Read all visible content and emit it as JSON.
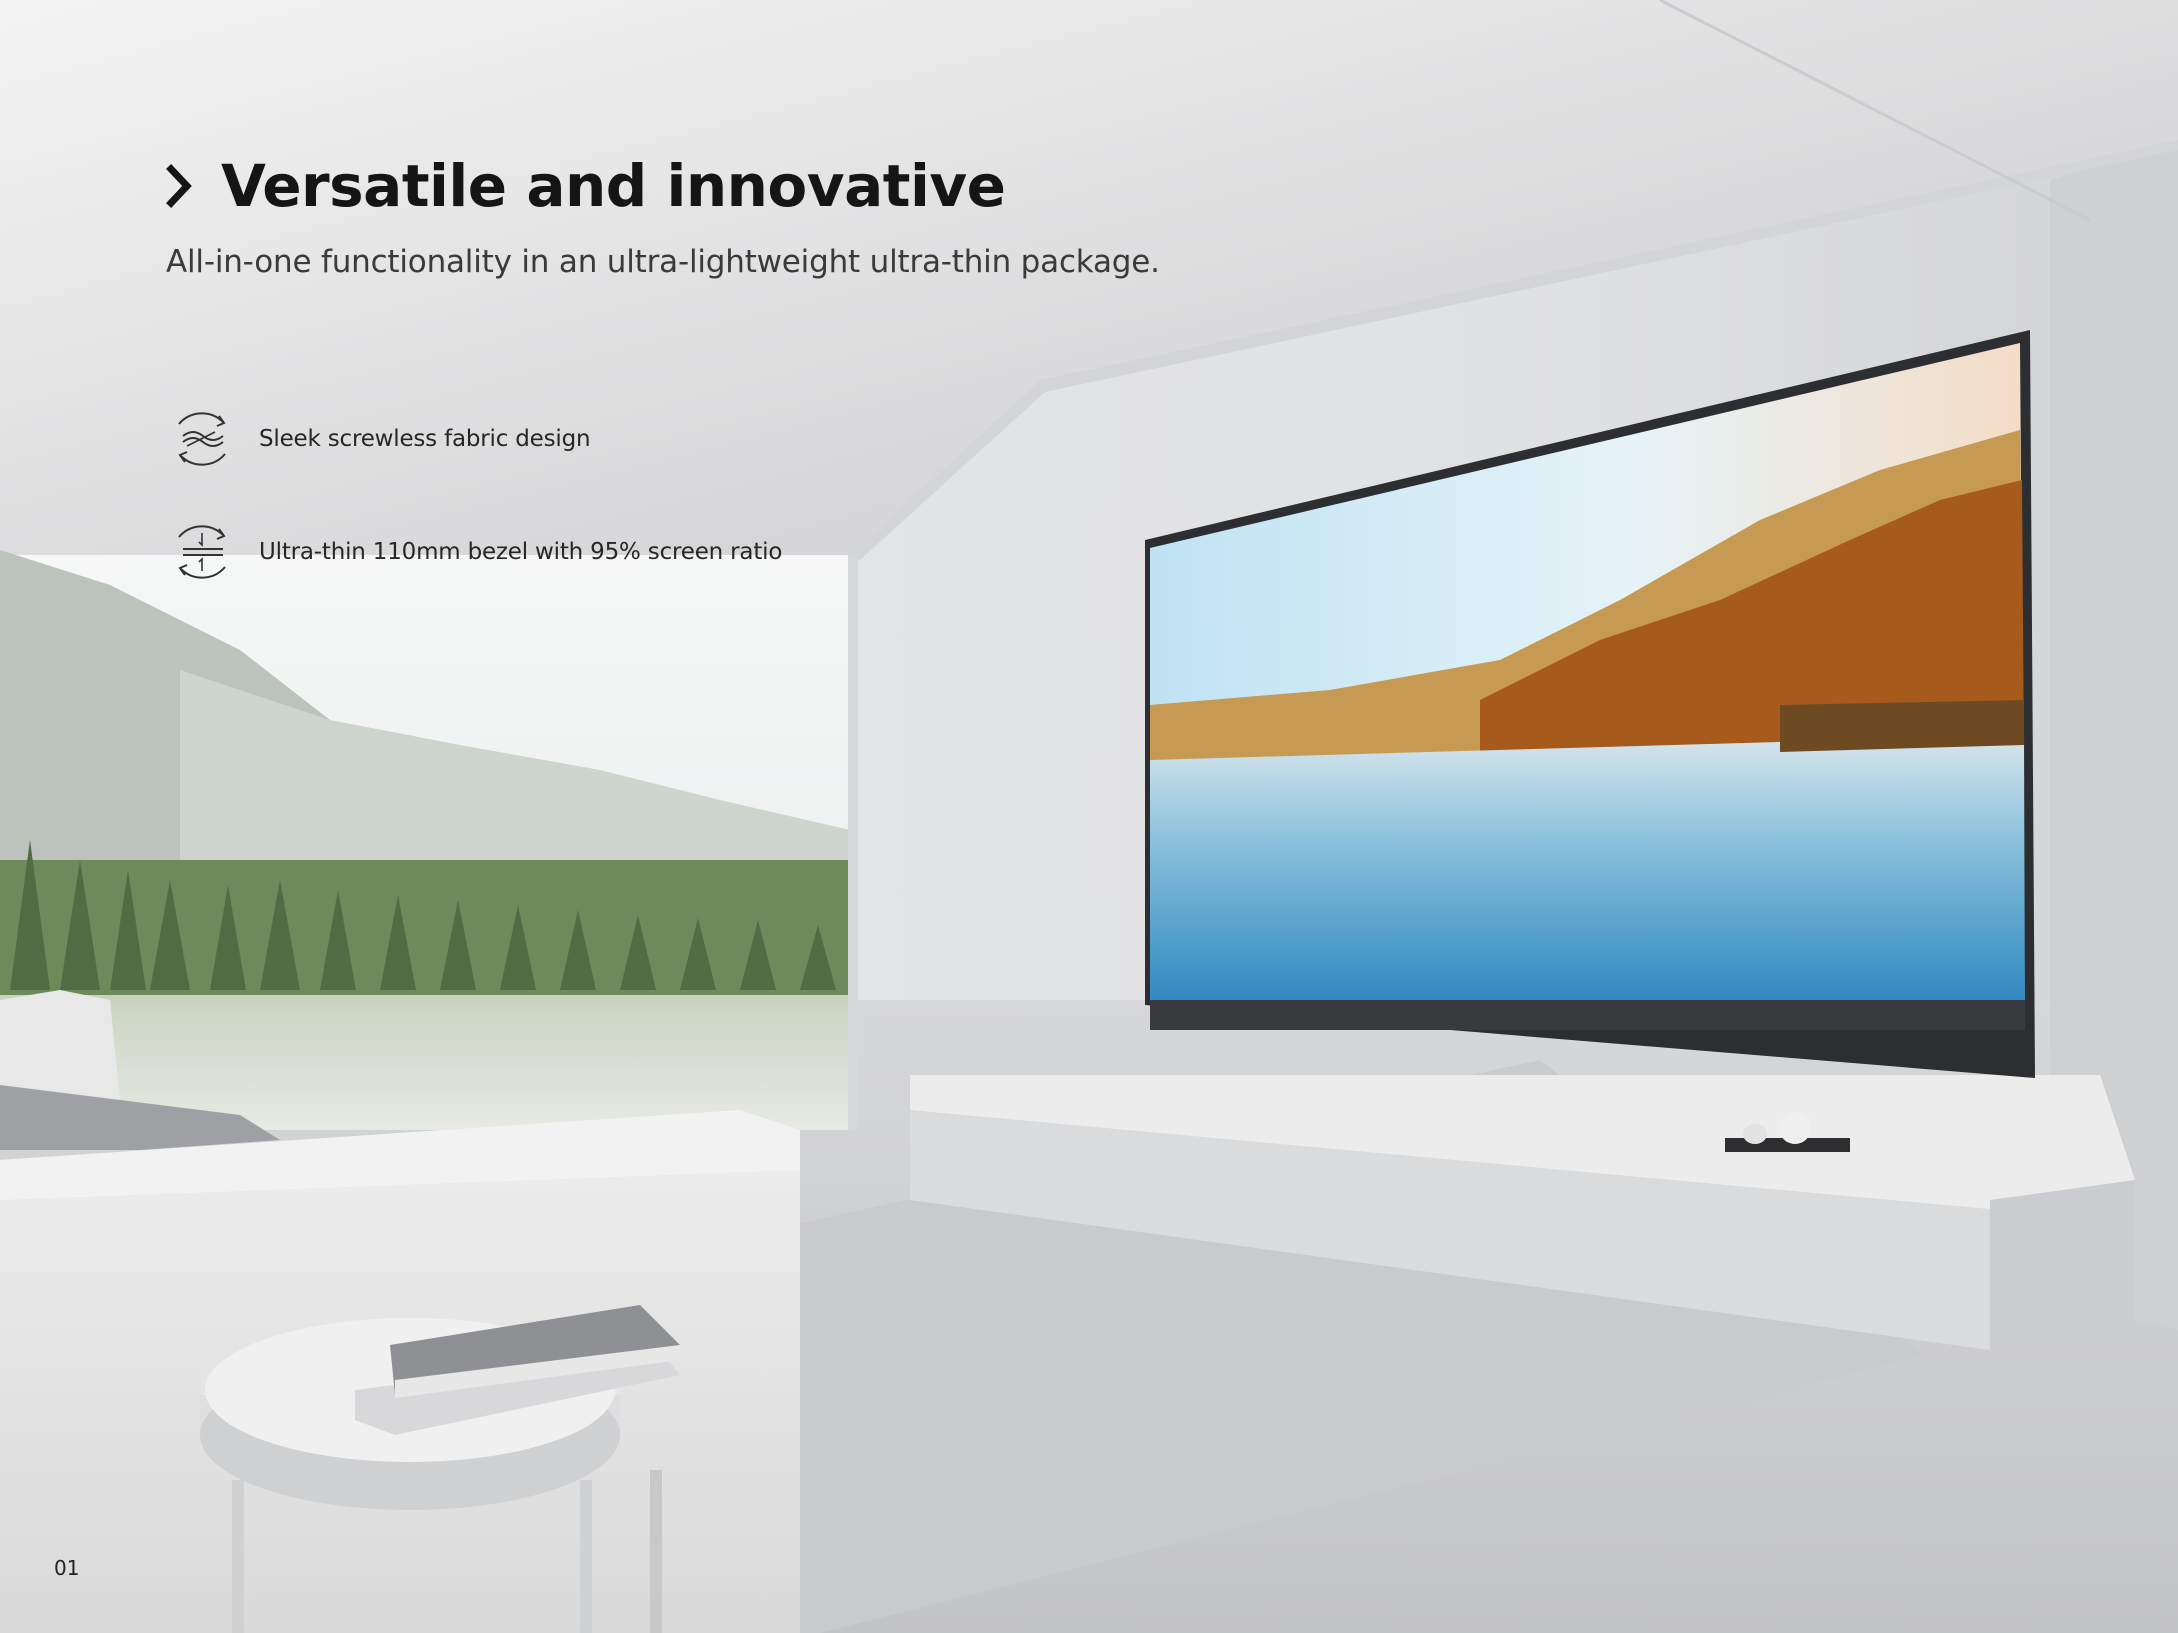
{
  "page": {
    "title": "Versatile and innovative",
    "subtitle": "All-in-one functionality in an ultra-lightweight ultra-thin package.",
    "features": [
      {
        "icon": "fabric-rotate-icon",
        "label": "Sleek screwless fabric design"
      },
      {
        "icon": "thin-bezel-icon",
        "label": "Ultra-thin 110mm bezel with 95% screen ratio"
      }
    ],
    "page_number": "01"
  },
  "colors": {
    "heading_text": "#151515",
    "body_text": "#3a3a3a",
    "wall": "#e3e4e6",
    "tv_frame": "#3a3b3e"
  }
}
